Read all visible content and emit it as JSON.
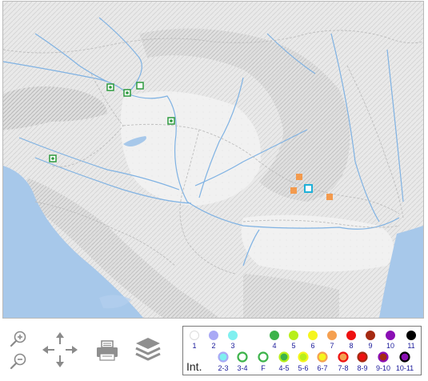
{
  "legend": {
    "title": "Int.",
    "top_row": [
      {
        "label": "1",
        "color": "#ffffff"
      },
      {
        "label": "2",
        "color": "#a9a9f5"
      },
      {
        "label": "3",
        "color": "#7ff0f0"
      },
      {
        "label": "4",
        "color": "#3cb34a"
      },
      {
        "label": "5",
        "color": "#b8ef1a"
      },
      {
        "label": "6",
        "color": "#f5f51c"
      },
      {
        "label": "7",
        "color": "#f5a050"
      },
      {
        "label": "8",
        "color": "#ee1111"
      },
      {
        "label": "9",
        "color": "#a52a12"
      },
      {
        "label": "10",
        "color": "#8a0fb4"
      },
      {
        "label": "11",
        "color": "#000000"
      }
    ],
    "bottom_row": [
      {
        "label": "2-3",
        "fill": "#7ff0f0",
        "ring": "#a9a9f5"
      },
      {
        "label": "3-4",
        "fill": "#ffffff",
        "ring": "#3cb34a"
      },
      {
        "label": "F",
        "fill": "#ffffff",
        "ring": "#3cb34a"
      },
      {
        "label": "4-5",
        "fill": "#3cb34a",
        "ring": "#b8ef1a"
      },
      {
        "label": "5-6",
        "fill": "#b8ef1a",
        "ring": "#f5f51c"
      },
      {
        "label": "6-7",
        "fill": "#f5f51c",
        "ring": "#f5a050"
      },
      {
        "label": "7-8",
        "fill": "#f5a050",
        "ring": "#ee1111"
      },
      {
        "label": "8-9",
        "fill": "#ee1111",
        "ring": "#a52a12"
      },
      {
        "label": "9-10",
        "fill": "#a52a12",
        "ring": "#8a0fb4"
      },
      {
        "label": "10-11",
        "fill": "#8a0fb4",
        "ring": "#000000"
      }
    ]
  },
  "map": {
    "green_markers": [
      "marker-1",
      "marker-2",
      "marker-3",
      "marker-4",
      "marker-5"
    ],
    "orange_markers": [
      "marker-6",
      "marker-7",
      "marker-8"
    ],
    "cyan_markers": [
      "marker-9"
    ]
  },
  "colors": {
    "land": "#ececec",
    "water": "#a7c8ea",
    "rivers": "#7fb2e3",
    "borders": "#bdbdbd",
    "green_marker": "#2e9a3f",
    "orange_marker": "#f39a4d",
    "cyan_marker": "#1fb0d8"
  },
  "toolbar": {
    "icons": [
      "zoom-in-icon",
      "zoom-out-icon",
      "pan-icon",
      "print-icon",
      "layers-icon"
    ]
  }
}
